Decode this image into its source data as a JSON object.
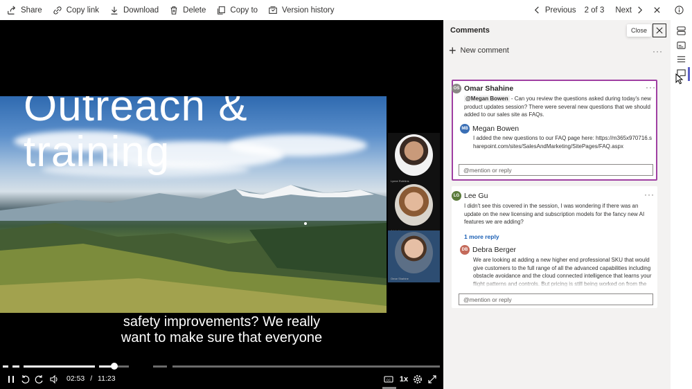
{
  "toolbar": {
    "share": "Share",
    "copy_link": "Copy link",
    "download": "Download",
    "delete": "Delete",
    "copy_to": "Copy to",
    "version_history": "Version history",
    "previous": "Previous",
    "counter": "2 of 3",
    "next": "Next"
  },
  "video": {
    "title_line1": "Outreach &",
    "title_line2": "training",
    "caption_line1": "safety improvements? We really",
    "caption_line2": "want to make sure that everyone",
    "current_time": "02:53",
    "separator": "/",
    "duration": "11:23",
    "speed": "1x",
    "progress": 0.254,
    "gallery_captions": [
      "Lynne Robbins",
      "Adele Vance",
      "Omar Shahine"
    ]
  },
  "comments_panel": {
    "title": "Comments",
    "close_tooltip": "Close",
    "new_comment": "New comment",
    "threads": [
      {
        "author": "Omar Shahine",
        "initials": "OS",
        "avatar_color": "#8a8886",
        "mention": "@Megan Bowen",
        "text": " - Can you review the questions asked during today's new product updates session? There were several new questions that we should added to our sales site as FAQs.",
        "reply_author": "Megan Bowen",
        "reply_initials": "MB",
        "reply_avatar_color": "#3a6fb5",
        "reply_text": "I added the new questions to our FAQ page here: https://m365x970716.sharepoint.com/sites/SalesAndMarketing/SitePages/FAQ.aspx",
        "reply_placeholder": "@mention or reply"
      },
      {
        "author": "Lee Gu",
        "initials": "LG",
        "avatar_color": "#5a7a3a",
        "text": "I didn't see this covered in the session, I was wondering if there was an update on the new licensing and subscription models for the fancy new AI features we are adding?",
        "more_replies": "1 more reply",
        "reply_author": "Debra Berger",
        "reply_initials": "DB",
        "reply_avatar_color": "#c46a5a",
        "reply_text": "We are looking at adding a new higher end professional SKU that would give customers to the full range of all the advanced capabilities including obstacle avoidance and the cloud connected intelligence that learns your flight patterns and controls. But pricing is still being worked on from the",
        "reply_placeholder": "@mention or reply"
      }
    ]
  },
  "colors": {
    "selected_border": "#9f3fa2",
    "link": "#1a5fb4",
    "rail_accent": "#5b5fc7"
  }
}
